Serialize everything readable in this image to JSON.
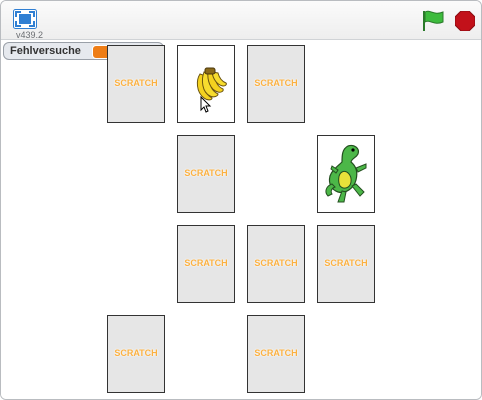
{
  "toolbar": {
    "version": "v439.2",
    "green_flag_color": "#2ea52e",
    "stop_color": "#c2111a"
  },
  "monitor": {
    "label": "Fehlversuche",
    "value": "11",
    "value_color": "#ee7d16"
  },
  "cards": {
    "back_text": "SCRATCH",
    "back_text_color": "#fbb040",
    "list": [
      {
        "state": "back"
      },
      {
        "state": "face",
        "picture": "banana"
      },
      {
        "state": "back"
      },
      {
        "state": "back"
      },
      {
        "state": "face",
        "picture": "dinosaur"
      },
      {
        "state": "back"
      },
      {
        "state": "back"
      },
      {
        "state": "back"
      },
      {
        "state": "back"
      },
      {
        "state": "back"
      }
    ]
  },
  "cursor": "arrow-cursor-icon"
}
